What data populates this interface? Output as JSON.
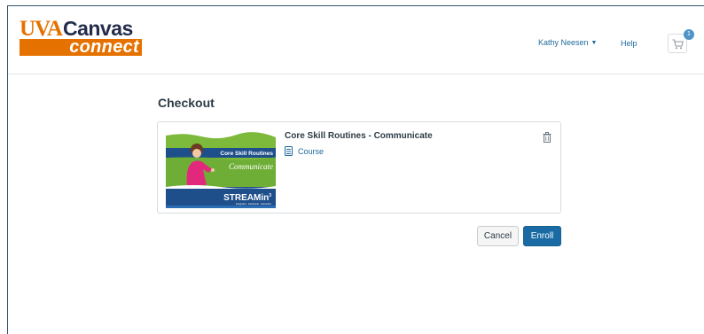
{
  "header": {
    "logo": {
      "uva": "UVA",
      "canvas": "Canvas",
      "connect": "connect"
    },
    "user_name": "Kathy Neesen",
    "help_label": "Help",
    "cart_count": "1",
    "cart_icon": "shopping-cart-icon"
  },
  "main": {
    "title": "Checkout",
    "cart_item": {
      "thumbnail": {
        "title": "Core Skill Routines",
        "subtitle": "Communicate",
        "brand": "STREAMin",
        "brand_superscript": "3",
        "tagline": "Integrated · Intentional · Interactive"
      },
      "title": "Core Skill Routines - Communicate",
      "type_label": "Course",
      "type_icon": "course-icon",
      "remove_icon": "trash-icon"
    },
    "actions": {
      "cancel_label": "Cancel",
      "enroll_label": "Enroll"
    }
  },
  "colors": {
    "brand_orange": "#e57200",
    "brand_navy": "#232d4b",
    "link_blue": "#1f6a9b",
    "primary_button": "#1a6ba4",
    "thumbnail_green": "#7db93a",
    "thumbnail_navy": "#1f4f8b",
    "thumbnail_pink": "#e2287c"
  }
}
